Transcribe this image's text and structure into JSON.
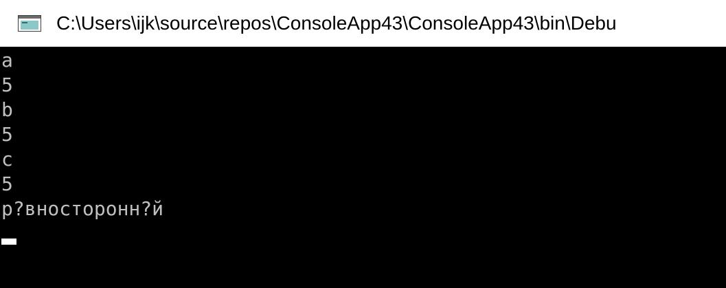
{
  "window": {
    "title": "C:\\Users\\ijk\\source\\repos\\ConsoleApp43\\ConsoleApp43\\bin\\Debu",
    "icon": "console-window-icon"
  },
  "console": {
    "lines": [
      "a",
      "5",
      "b",
      "5",
      "c",
      "5",
      "р?вносторонн?й"
    ]
  },
  "colors": {
    "console_background": "#000000",
    "console_text": "#c0c0c0",
    "titlebar_background": "#ffffff",
    "cursor": "#ffffff"
  }
}
